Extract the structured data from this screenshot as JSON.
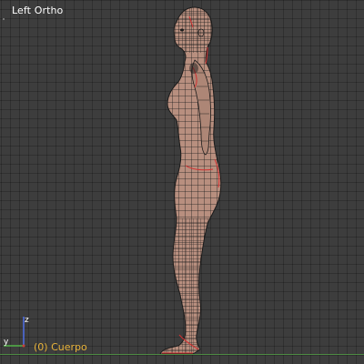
{
  "viewport": {
    "view_name": "Left Ortho",
    "active_object": "(0) Cuerpo",
    "colors": {
      "background": "#3d3d3d",
      "grid": "#353535",
      "ground_line": "#4d8a43",
      "object_text": "#e8b33a",
      "view_text": "#ffffff",
      "mesh_fill": "#b88f7f",
      "mesh_wire": "#1c1c1c",
      "seam_wire": "#d23030",
      "axis_x": "#c8403a",
      "axis_y": "#54b548",
      "axis_z": "#4f6ee6"
    }
  },
  "axis_gizmo": {
    "y_label": "y",
    "z_label": "z"
  }
}
